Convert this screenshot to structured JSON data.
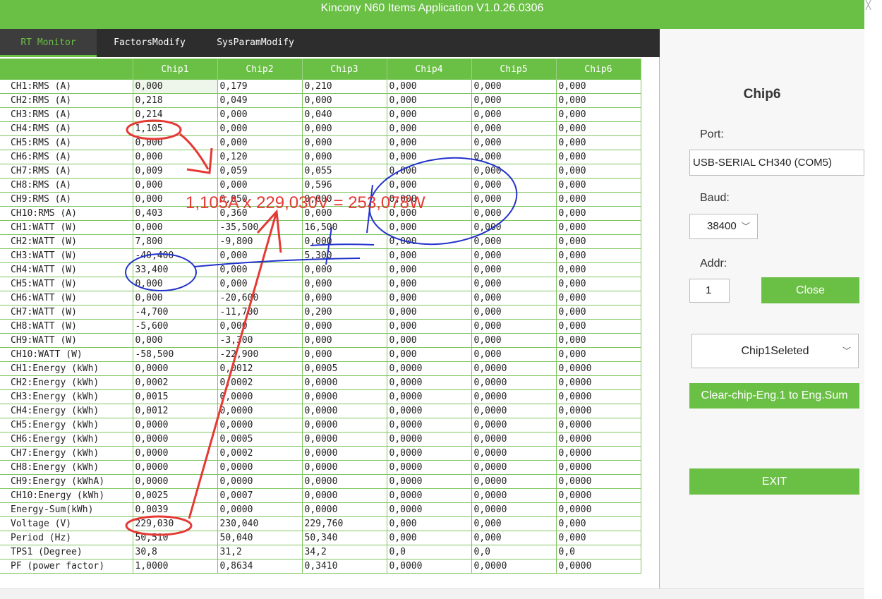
{
  "window": {
    "title": "Kincony N60 Items Application V1.0.26.0306"
  },
  "tabs": [
    {
      "label": "RT Monitor",
      "active": true
    },
    {
      "label": "FactorsModify",
      "active": false
    },
    {
      "label": "SysParamModify",
      "active": false
    }
  ],
  "grid": {
    "columns": [
      "Chip1",
      "Chip2",
      "Chip3",
      "Chip4",
      "Chip5",
      "Chip6"
    ],
    "rows": [
      {
        "label": "CH1:RMS (A)",
        "values": [
          "0,000",
          "0,179",
          "0,210",
          "0,000",
          "0,000",
          "0,000"
        ]
      },
      {
        "label": "CH2:RMS (A)",
        "values": [
          "0,218",
          "0,049",
          "0,000",
          "0,000",
          "0,000",
          "0,000"
        ]
      },
      {
        "label": "CH3:RMS (A)",
        "values": [
          "0,214",
          "0,000",
          "0,040",
          "0,000",
          "0,000",
          "0,000"
        ]
      },
      {
        "label": "CH4:RMS (A)",
        "values": [
          "1,105",
          "0,000",
          "0,000",
          "0,000",
          "0,000",
          "0,000"
        ]
      },
      {
        "label": "CH5:RMS (A)",
        "values": [
          "0,000",
          "0,000",
          "0,000",
          "0,000",
          "0,000",
          "0,000"
        ]
      },
      {
        "label": "CH6:RMS (A)",
        "values": [
          "0,000",
          "0,120",
          "0,000",
          "0,000",
          "0,000",
          "0,000"
        ]
      },
      {
        "label": "CH7:RMS (A)",
        "values": [
          "0,009",
          "0,059",
          "0,055",
          "0,000",
          "0,000",
          "0,000"
        ]
      },
      {
        "label": "CH8:RMS (A)",
        "values": [
          "0,000",
          "0,000",
          "0,596",
          "0,000",
          "0,000",
          "0,000"
        ]
      },
      {
        "label": "CH9:RMS (A)",
        "values": [
          "0,000",
          "0,050",
          "0,000",
          "0,000",
          "0,000",
          "0,000"
        ]
      },
      {
        "label": "CH10:RMS (A)",
        "values": [
          "0,403",
          "0,360",
          "0,000",
          "0,000",
          "0,000",
          "0,000"
        ]
      },
      {
        "label": "CH1:WATT (W)",
        "values": [
          "0,000",
          "-35,500",
          "16,500",
          "0,000",
          "0,000",
          "0,000"
        ]
      },
      {
        "label": "CH2:WATT (W)",
        "values": [
          "7,800",
          "-9,800",
          "0,000",
          "0,000",
          "0,000",
          "0,000"
        ]
      },
      {
        "label": "CH3:WATT (W)",
        "values": [
          "-40,400",
          "0,000",
          "5,300",
          "0,000",
          "0,000",
          "0,000"
        ]
      },
      {
        "label": "CH4:WATT (W)",
        "values": [
          "33,400",
          "0,000",
          "0,000",
          "0,000",
          "0,000",
          "0,000"
        ]
      },
      {
        "label": "CH5:WATT (W)",
        "values": [
          "0,000",
          "0,000",
          "0,000",
          "0,000",
          "0,000",
          "0,000"
        ]
      },
      {
        "label": "CH6:WATT (W)",
        "values": [
          "0,000",
          "-20,600",
          "0,000",
          "0,000",
          "0,000",
          "0,000"
        ]
      },
      {
        "label": "CH7:WATT (W)",
        "values": [
          "-4,700",
          "-11,700",
          "0,200",
          "0,000",
          "0,000",
          "0,000"
        ]
      },
      {
        "label": "CH8:WATT (W)",
        "values": [
          "-5,600",
          "0,000",
          "0,000",
          "0,000",
          "0,000",
          "0,000"
        ]
      },
      {
        "label": "CH9:WATT (W)",
        "values": [
          "0,000",
          "-3,300",
          "0,000",
          "0,000",
          "0,000",
          "0,000"
        ]
      },
      {
        "label": "CH10:WATT (W)",
        "values": [
          "-58,500",
          "-22,900",
          "0,000",
          "0,000",
          "0,000",
          "0,000"
        ]
      },
      {
        "label": "CH1:Energy (kWh)",
        "values": [
          "0,0000",
          "0,0012",
          "0,0005",
          "0,0000",
          "0,0000",
          "0,0000"
        ]
      },
      {
        "label": "CH2:Energy (kWh)",
        "values": [
          "0,0002",
          "0,0002",
          "0,0000",
          "0,0000",
          "0,0000",
          "0,0000"
        ]
      },
      {
        "label": "CH3:Energy (kWh)",
        "values": [
          "0,0015",
          "0,0000",
          "0,0000",
          "0,0000",
          "0,0000",
          "0,0000"
        ]
      },
      {
        "label": "CH4:Energy (kWh)",
        "values": [
          "0,0012",
          "0,0000",
          "0,0000",
          "0,0000",
          "0,0000",
          "0,0000"
        ]
      },
      {
        "label": "CH5:Energy (kWh)",
        "values": [
          "0,0000",
          "0,0000",
          "0,0000",
          "0,0000",
          "0,0000",
          "0,0000"
        ]
      },
      {
        "label": "CH6:Energy (kWh)",
        "values": [
          "0,0000",
          "0,0005",
          "0,0000",
          "0,0000",
          "0,0000",
          "0,0000"
        ]
      },
      {
        "label": "CH7:Energy (kWh)",
        "values": [
          "0,0000",
          "0,0002",
          "0,0000",
          "0,0000",
          "0,0000",
          "0,0000"
        ]
      },
      {
        "label": "CH8:Energy (kWh)",
        "values": [
          "0,0000",
          "0,0000",
          "0,0000",
          "0,0000",
          "0,0000",
          "0,0000"
        ]
      },
      {
        "label": "CH9:Energy (kWhA)",
        "values": [
          "0,0000",
          "0,0000",
          "0,0000",
          "0,0000",
          "0,0000",
          "0,0000"
        ]
      },
      {
        "label": "CH10:Energy (kWh)",
        "values": [
          "0,0025",
          "0,0007",
          "0,0000",
          "0,0000",
          "0,0000",
          "0,0000"
        ]
      },
      {
        "label": "Energy-Sum(kWh)",
        "values": [
          "0,0039",
          "0,0000",
          "0,0000",
          "0,0000",
          "0,0000",
          "0,0000"
        ]
      },
      {
        "label": "Voltage (V)",
        "values": [
          "229,030",
          "230,040",
          "229,760",
          "0,000",
          "0,000",
          "0,000"
        ]
      },
      {
        "label": "Period (Hz)",
        "values": [
          "50,510",
          "50,040",
          "50,340",
          "0,000",
          "0,000",
          "0,000"
        ]
      },
      {
        "label": "TPS1 (Degree)",
        "values": [
          "30,8",
          "31,2",
          "34,2",
          "0,0",
          "0,0",
          "0,0"
        ]
      },
      {
        "label": "PF (power factor)",
        "values": [
          "1,0000",
          "0,8634",
          "0,3410",
          "0,0000",
          "0,0000",
          "0,0000"
        ]
      }
    ]
  },
  "side": {
    "chip_title": "Chip6",
    "port_label": "Port:",
    "port_value": "USB-SERIAL CH340 (COM5)",
    "baud_label": "Baud:",
    "baud_value": "38400",
    "addr_label": "Addr:",
    "addr_value": "1",
    "close_label": "Close",
    "chip_select_value": "Chip1Seleted",
    "clear_label": "Clear-chip-Eng.1 to Eng.Sum",
    "exit_label": "EXIT"
  },
  "annotation": {
    "formula": "1,105A x 229,030V = 253,078W"
  },
  "colors": {
    "accent": "#6abf45",
    "tabbar": "#2d2d2d",
    "annotation_red": "#e53935",
    "annotation_blue": "#2233cc"
  }
}
